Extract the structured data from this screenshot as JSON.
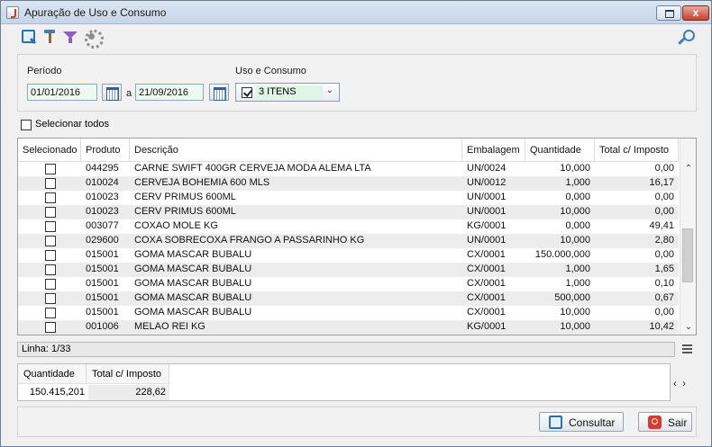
{
  "window": {
    "title": "Apuração de Uso e Consumo",
    "close_glyph": "x"
  },
  "filters": {
    "periodo_label": "Período",
    "date_from": "01/01/2016",
    "date_sep": "a",
    "date_to": "21/09/2016",
    "uso_label": "Uso e Consumo",
    "uso_value": "3 ITENS",
    "select_all_label": "Selecionar todos"
  },
  "grid": {
    "columns": [
      "Selecionado",
      "Produto",
      "Descrição",
      "Embalagem",
      "Quantidade",
      "Total c/ Imposto"
    ],
    "rows": [
      {
        "produto": "044295",
        "descricao": "CARNE SWIFT 400GR CERVEJA MODA ALEMA LTA",
        "embalagem": "UN/0024",
        "quantidade": "10,000",
        "total": "0,00"
      },
      {
        "produto": "010024",
        "descricao": "CERVEJA BOHEMIA 600 MLS",
        "embalagem": "UN/0012",
        "quantidade": "1,000",
        "total": "16,17"
      },
      {
        "produto": "010023",
        "descricao": "CERV PRIMUS 600ML",
        "embalagem": "UN/0001",
        "quantidade": "0,000",
        "total": "0,00"
      },
      {
        "produto": "010023",
        "descricao": "CERV PRIMUS 600ML",
        "embalagem": "UN/0001",
        "quantidade": "10,000",
        "total": "0,00"
      },
      {
        "produto": "003077",
        "descricao": "COXAO MOLE KG",
        "embalagem": "KG/0001",
        "quantidade": "0,000",
        "total": "49,41"
      },
      {
        "produto": "029600",
        "descricao": "COXA SOBRECOXA FRANGO A PASSARINHO KG",
        "embalagem": "UN/0001",
        "quantidade": "10,000",
        "total": "2,80"
      },
      {
        "produto": "015001",
        "descricao": "GOMA MASCAR BUBALU",
        "embalagem": "CX/0001",
        "quantidade": "150.000,000",
        "total": "0,00"
      },
      {
        "produto": "015001",
        "descricao": "GOMA MASCAR BUBALU",
        "embalagem": "CX/0001",
        "quantidade": "1,000",
        "total": "1,65"
      },
      {
        "produto": "015001",
        "descricao": "GOMA MASCAR BUBALU",
        "embalagem": "CX/0001",
        "quantidade": "1,000",
        "total": "0,10"
      },
      {
        "produto": "015001",
        "descricao": "GOMA MASCAR BUBALU",
        "embalagem": "CX/0001",
        "quantidade": "500,000",
        "total": "0,67"
      },
      {
        "produto": "015001",
        "descricao": "GOMA MASCAR BUBALU",
        "embalagem": "CX/0001",
        "quantidade": "10,000",
        "total": "0,00"
      },
      {
        "produto": "001006",
        "descricao": "MELAO REI KG",
        "embalagem": "KG/0001",
        "quantidade": "10,000",
        "total": "10,42"
      }
    ]
  },
  "status": {
    "linha": "Linha: 1/33"
  },
  "totals": {
    "quantidade_label": "Quantidade",
    "total_label": "Total c/ Imposto",
    "quantidade_value": "150.415,201",
    "total_value": "228,62"
  },
  "buttons": {
    "consultar": "Consultar",
    "sair": "Sair"
  },
  "icons": {
    "toolbar": [
      "search-icon",
      "tools-icon",
      "filter-icon",
      "gear-icon"
    ],
    "right": "key-icon"
  }
}
